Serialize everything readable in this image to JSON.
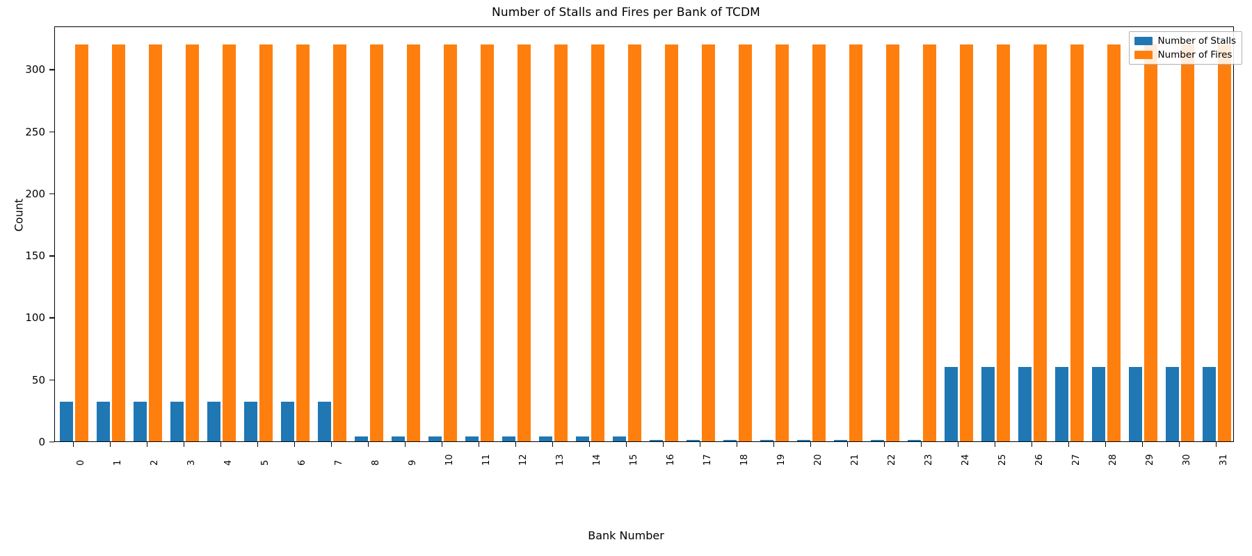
{
  "chart_data": {
    "type": "bar",
    "title": "Number of Stalls and Fires per Bank of TCDM",
    "xlabel": "Bank Number",
    "ylabel": "Count",
    "grid": false,
    "legend_position": "upper right",
    "ylim": [
      0,
      335
    ],
    "yticks": [
      0,
      50,
      100,
      150,
      200,
      250,
      300
    ],
    "ytick_labels": [
      "0",
      "50",
      "100",
      "150",
      "200",
      "250",
      "300"
    ],
    "categories": [
      "0",
      "1",
      "2",
      "3",
      "4",
      "5",
      "6",
      "7",
      "8",
      "9",
      "10",
      "11",
      "12",
      "13",
      "14",
      "15",
      "16",
      "17",
      "18",
      "19",
      "20",
      "21",
      "22",
      "23",
      "24",
      "25",
      "26",
      "27",
      "28",
      "29",
      "30",
      "31"
    ],
    "xtick_rotation": 90,
    "series": [
      {
        "name": "Number of Stalls",
        "color": "#1f77b4",
        "values": [
          32,
          32,
          32,
          32,
          32,
          32,
          32,
          32,
          4,
          4,
          4,
          4,
          4,
          4,
          4,
          4,
          1,
          1,
          1,
          1,
          1,
          1,
          1,
          1,
          60,
          60,
          60,
          60,
          60,
          60,
          60,
          60
        ]
      },
      {
        "name": "Number of Fires",
        "color": "#ff7f0e",
        "values": [
          320,
          320,
          320,
          320,
          320,
          320,
          320,
          320,
          320,
          320,
          320,
          320,
          320,
          320,
          320,
          320,
          320,
          320,
          320,
          320,
          320,
          320,
          320,
          320,
          320,
          320,
          320,
          320,
          320,
          320,
          320,
          320
        ]
      }
    ]
  },
  "figure": {
    "background": "#ffffff",
    "axis_color": "#000000"
  }
}
